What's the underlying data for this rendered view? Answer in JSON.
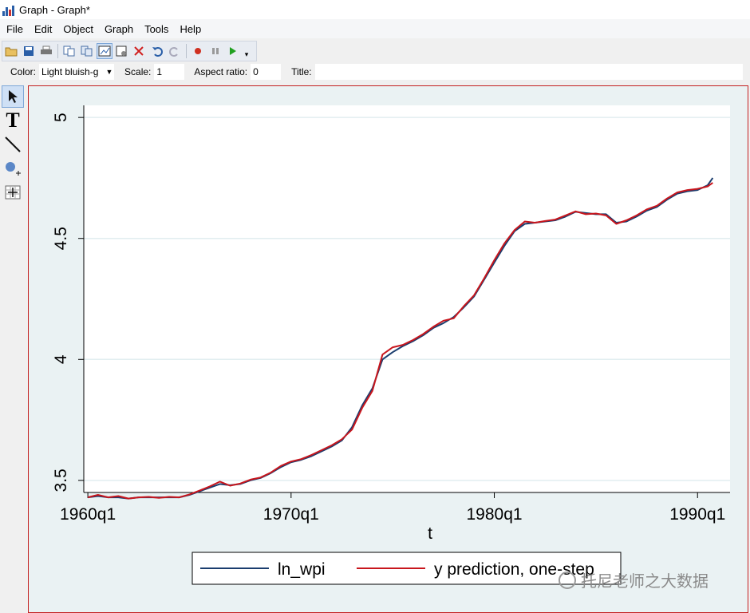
{
  "window": {
    "title": "Graph - Graph*"
  },
  "menu": [
    "File",
    "Edit",
    "Object",
    "Graph",
    "Tools",
    "Help"
  ],
  "toolbar": {
    "buttons": [
      "open-icon",
      "save-icon",
      "print-icon",
      "copy-icon",
      "copy-table-icon",
      "graph-editor-icon",
      "graph-recorder-icon",
      "delete-icon",
      "undo-icon",
      "redo-icon",
      "record-icon",
      "pause-icon",
      "play-icon",
      "more-icon"
    ]
  },
  "properties": {
    "color_label": "Color:",
    "color_value": "Light bluish-g",
    "scale_label": "Scale:",
    "scale_value": "1",
    "aspect_label": "Aspect ratio:",
    "aspect_value": "0",
    "title_label": "Title:",
    "title_value": ""
  },
  "left_tools": [
    "pointer-icon",
    "text-tool-icon",
    "line-tool-icon",
    "marker-tool-icon",
    "grid-edit-icon"
  ],
  "watermark": {
    "text": "托尼老师之大数据"
  },
  "colors": {
    "ln_wpi": "#1a3d6e",
    "prediction": "#c8161d",
    "plot_bg": "#ffffff",
    "outer_bg": "#eaf2f3",
    "grid": "#e2eef0"
  },
  "chart_data": {
    "type": "line",
    "title": "",
    "xlabel": "t",
    "ylabel": "",
    "xlim": [
      1959.8,
      1991.6
    ],
    "ylim": [
      3.45,
      5.05
    ],
    "x_ticks": [
      {
        "value": 1960,
        "label": "1960q1"
      },
      {
        "value": 1970,
        "label": "1970q1"
      },
      {
        "value": 1980,
        "label": "1980q1"
      },
      {
        "value": 1990,
        "label": "1990q1"
      }
    ],
    "y_ticks": [
      {
        "value": 3.5,
        "label": "3.5"
      },
      {
        "value": 4,
        "label": "4"
      },
      {
        "value": 4.5,
        "label": "4.5"
      },
      {
        "value": 5,
        "label": "5"
      }
    ],
    "grid": true,
    "legend_position": "bottom",
    "series": [
      {
        "name": "ln_wpi",
        "x": [
          1960.0,
          1960.5,
          1961.0,
          1961.5,
          1962.0,
          1962.5,
          1963.0,
          1963.5,
          1964.0,
          1964.5,
          1965.0,
          1965.5,
          1966.0,
          1966.5,
          1967.0,
          1967.5,
          1968.0,
          1968.5,
          1969.0,
          1969.5,
          1970.0,
          1970.5,
          1971.0,
          1971.5,
          1972.0,
          1972.5,
          1973.0,
          1973.5,
          1974.0,
          1974.5,
          1975.0,
          1975.5,
          1976.0,
          1976.5,
          1977.0,
          1977.5,
          1978.0,
          1978.5,
          1979.0,
          1979.5,
          1980.0,
          1980.5,
          1981.0,
          1981.5,
          1982.0,
          1982.5,
          1983.0,
          1983.5,
          1984.0,
          1984.5,
          1985.0,
          1985.5,
          1986.0,
          1986.5,
          1987.0,
          1987.5,
          1988.0,
          1988.5,
          1989.0,
          1989.5,
          1990.0,
          1990.5,
          1990.75
        ],
        "y": [
          3.43,
          3.435,
          3.43,
          3.43,
          3.425,
          3.43,
          3.43,
          3.43,
          3.43,
          3.43,
          3.44,
          3.455,
          3.47,
          3.485,
          3.48,
          3.485,
          3.5,
          3.51,
          3.53,
          3.555,
          3.575,
          3.585,
          3.6,
          3.62,
          3.64,
          3.665,
          3.72,
          3.81,
          3.88,
          4.0,
          4.03,
          4.055,
          4.075,
          4.1,
          4.13,
          4.15,
          4.175,
          4.215,
          4.26,
          4.33,
          4.4,
          4.47,
          4.53,
          4.56,
          4.565,
          4.57,
          4.575,
          4.59,
          4.61,
          4.605,
          4.6,
          4.6,
          4.565,
          4.57,
          4.59,
          4.615,
          4.63,
          4.66,
          4.685,
          4.695,
          4.7,
          4.72,
          4.75
        ]
      },
      {
        "name": "y prediction, one-step",
        "x": [
          1960.0,
          1960.5,
          1961.0,
          1961.5,
          1962.0,
          1962.5,
          1963.0,
          1963.5,
          1964.0,
          1964.5,
          1965.0,
          1965.5,
          1966.0,
          1966.5,
          1967.0,
          1967.5,
          1968.0,
          1968.5,
          1969.0,
          1969.5,
          1970.0,
          1970.5,
          1971.0,
          1971.5,
          1972.0,
          1972.5,
          1973.0,
          1973.5,
          1974.0,
          1974.5,
          1975.0,
          1975.5,
          1976.0,
          1976.5,
          1977.0,
          1977.5,
          1978.0,
          1978.5,
          1979.0,
          1979.5,
          1980.0,
          1980.5,
          1981.0,
          1981.5,
          1982.0,
          1982.5,
          1983.0,
          1983.5,
          1984.0,
          1984.5,
          1985.0,
          1985.5,
          1986.0,
          1986.5,
          1987.0,
          1987.5,
          1988.0,
          1988.5,
          1989.0,
          1989.5,
          1990.0,
          1990.5,
          1990.75
        ],
        "y": [
          3.43,
          3.44,
          3.43,
          3.435,
          3.425,
          3.43,
          3.432,
          3.428,
          3.432,
          3.43,
          3.442,
          3.458,
          3.475,
          3.495,
          3.478,
          3.487,
          3.503,
          3.512,
          3.532,
          3.56,
          3.578,
          3.588,
          3.605,
          3.625,
          3.645,
          3.67,
          3.71,
          3.8,
          3.87,
          4.02,
          4.05,
          4.06,
          4.08,
          4.105,
          4.135,
          4.16,
          4.17,
          4.22,
          4.265,
          4.335,
          4.41,
          4.48,
          4.535,
          4.57,
          4.565,
          4.572,
          4.578,
          4.595,
          4.612,
          4.6,
          4.603,
          4.595,
          4.56,
          4.575,
          4.595,
          4.62,
          4.635,
          4.665,
          4.69,
          4.7,
          4.705,
          4.715,
          4.73
        ]
      }
    ]
  }
}
